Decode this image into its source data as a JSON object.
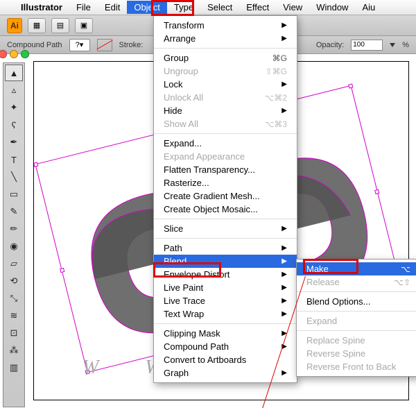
{
  "menubar": {
    "app": "Illustrator",
    "items": [
      "File",
      "Edit",
      "Object",
      "Type",
      "Select",
      "Effect",
      "View",
      "Window",
      "Aiu"
    ],
    "active": "Object"
  },
  "toolbar1": {
    "logo": "Ai"
  },
  "toolbar2": {
    "path_label": "Compound Path",
    "question": "?",
    "stroke_label": "Stroke:",
    "opacity_label": "Opacity:",
    "opacity_value": "100",
    "percent": "%"
  },
  "object_menu": [
    {
      "label": "Transform",
      "sub": true
    },
    {
      "label": "Arrange",
      "sub": true
    },
    {
      "sep": true
    },
    {
      "label": "Group",
      "sc": "⌘G"
    },
    {
      "label": "Ungroup",
      "sc": "⇧⌘G",
      "dis": true
    },
    {
      "label": "Lock",
      "sub": true
    },
    {
      "label": "Unlock All",
      "sc": "⌥⌘2",
      "dis": true
    },
    {
      "label": "Hide",
      "sub": true
    },
    {
      "label": "Show All",
      "sc": "⌥⌘3",
      "dis": true
    },
    {
      "sep": true
    },
    {
      "label": "Expand..."
    },
    {
      "label": "Expand Appearance",
      "dis": true
    },
    {
      "label": "Flatten Transparency..."
    },
    {
      "label": "Rasterize..."
    },
    {
      "label": "Create Gradient Mesh..."
    },
    {
      "label": "Create Object Mosaic..."
    },
    {
      "sep": true
    },
    {
      "label": "Slice",
      "sub": true
    },
    {
      "sep": true
    },
    {
      "label": "Path",
      "sub": true
    },
    {
      "label": "Blend",
      "sub": true,
      "hi": true
    },
    {
      "label": "Envelope Distort",
      "sub": true
    },
    {
      "label": "Live Paint",
      "sub": true
    },
    {
      "label": "Live Trace",
      "sub": true
    },
    {
      "label": "Text Wrap",
      "sub": true
    },
    {
      "sep": true
    },
    {
      "label": "Clipping Mask",
      "sub": true
    },
    {
      "label": "Compound Path",
      "sub": true
    },
    {
      "label": "Convert to Artboards"
    },
    {
      "label": "Graph",
      "sub": true
    }
  ],
  "blend_submenu": [
    {
      "label": "Make",
      "sc": "⌥",
      "hi": true
    },
    {
      "label": "Release",
      "sc": "⌥⇧",
      "dis": true
    },
    {
      "sep": true
    },
    {
      "label": "Blend Options..."
    },
    {
      "sep": true
    },
    {
      "label": "Expand",
      "dis": true
    },
    {
      "sep": true
    },
    {
      "label": "Replace Spine",
      "dis": true
    },
    {
      "label": "Reverse Spine",
      "dis": true
    },
    {
      "label": "Reverse Front to Back",
      "dis": true
    }
  ],
  "canvas": {
    "www": "W  W  W"
  }
}
